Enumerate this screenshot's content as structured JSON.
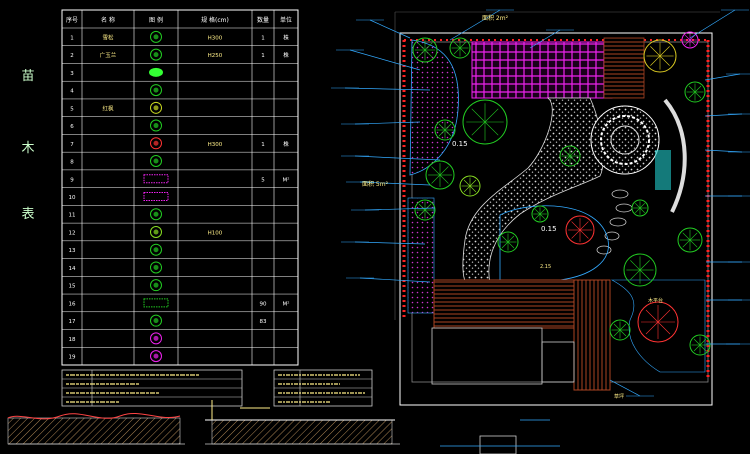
{
  "legend_table": {
    "side_title_chars": [
      "苗",
      "木",
      "表"
    ],
    "headers": [
      "序号",
      "名 称",
      "图 例",
      "规 格(cm)",
      "数量",
      "单位"
    ],
    "rows": [
      {
        "no": "1",
        "name": "雪松",
        "spec": "H300",
        "qty": "1",
        "unit": "株"
      },
      {
        "no": "2",
        "name": "广玉兰",
        "spec": "H250",
        "qty": "1",
        "unit": "株"
      },
      {
        "no": "3",
        "name": "",
        "spec": "",
        "qty": "",
        "unit": ""
      },
      {
        "no": "4",
        "name": "",
        "spec": "",
        "qty": "",
        "unit": ""
      },
      {
        "no": "5",
        "name": "红枫",
        "spec": "",
        "qty": "",
        "unit": ""
      },
      {
        "no": "6",
        "name": "",
        "spec": "",
        "qty": "",
        "unit": ""
      },
      {
        "no": "7",
        "name": "",
        "spec": "H300",
        "qty": "1",
        "unit": "株"
      },
      {
        "no": "8",
        "name": "",
        "spec": "",
        "qty": "",
        "unit": ""
      },
      {
        "no": "9",
        "name": "",
        "spec": "",
        "qty": "5",
        "unit": "M²"
      },
      {
        "no": "10",
        "name": "",
        "spec": "",
        "qty": "",
        "unit": ""
      },
      {
        "no": "11",
        "name": "",
        "spec": "",
        "qty": "",
        "unit": ""
      },
      {
        "no": "12",
        "name": "",
        "spec": "H100",
        "qty": "",
        "unit": ""
      },
      {
        "no": "13",
        "name": "",
        "spec": "",
        "qty": "",
        "unit": ""
      },
      {
        "no": "14",
        "name": "",
        "spec": "",
        "qty": "",
        "unit": ""
      },
      {
        "no": "15",
        "name": "",
        "spec": "",
        "qty": "",
        "unit": ""
      },
      {
        "no": "16",
        "name": "",
        "spec": "",
        "qty": "90",
        "unit": "M²"
      },
      {
        "no": "17",
        "name": "",
        "spec": "",
        "qty": "83",
        "unit": ""
      },
      {
        "no": "18",
        "name": "",
        "spec": "",
        "qty": "",
        "unit": ""
      },
      {
        "no": "19",
        "name": "",
        "spec": "",
        "qty": "",
        "unit": ""
      }
    ]
  },
  "plan_labels": {
    "area_top": "面积 2m²",
    "area_mid": "面积 5m²",
    "dim_1": "0.15",
    "dim_2": "0.15",
    "dim_3": "2.15",
    "label_deck": "木平台",
    "label_lawn": "草坪"
  },
  "colors": {
    "table_line": "#ffffff",
    "boundary": "#ffffff",
    "leader": "#33aaff",
    "green": "#22cc22",
    "red": "#ff2222",
    "magenta": "#ee22ee",
    "wood": "#8b3a1a"
  }
}
